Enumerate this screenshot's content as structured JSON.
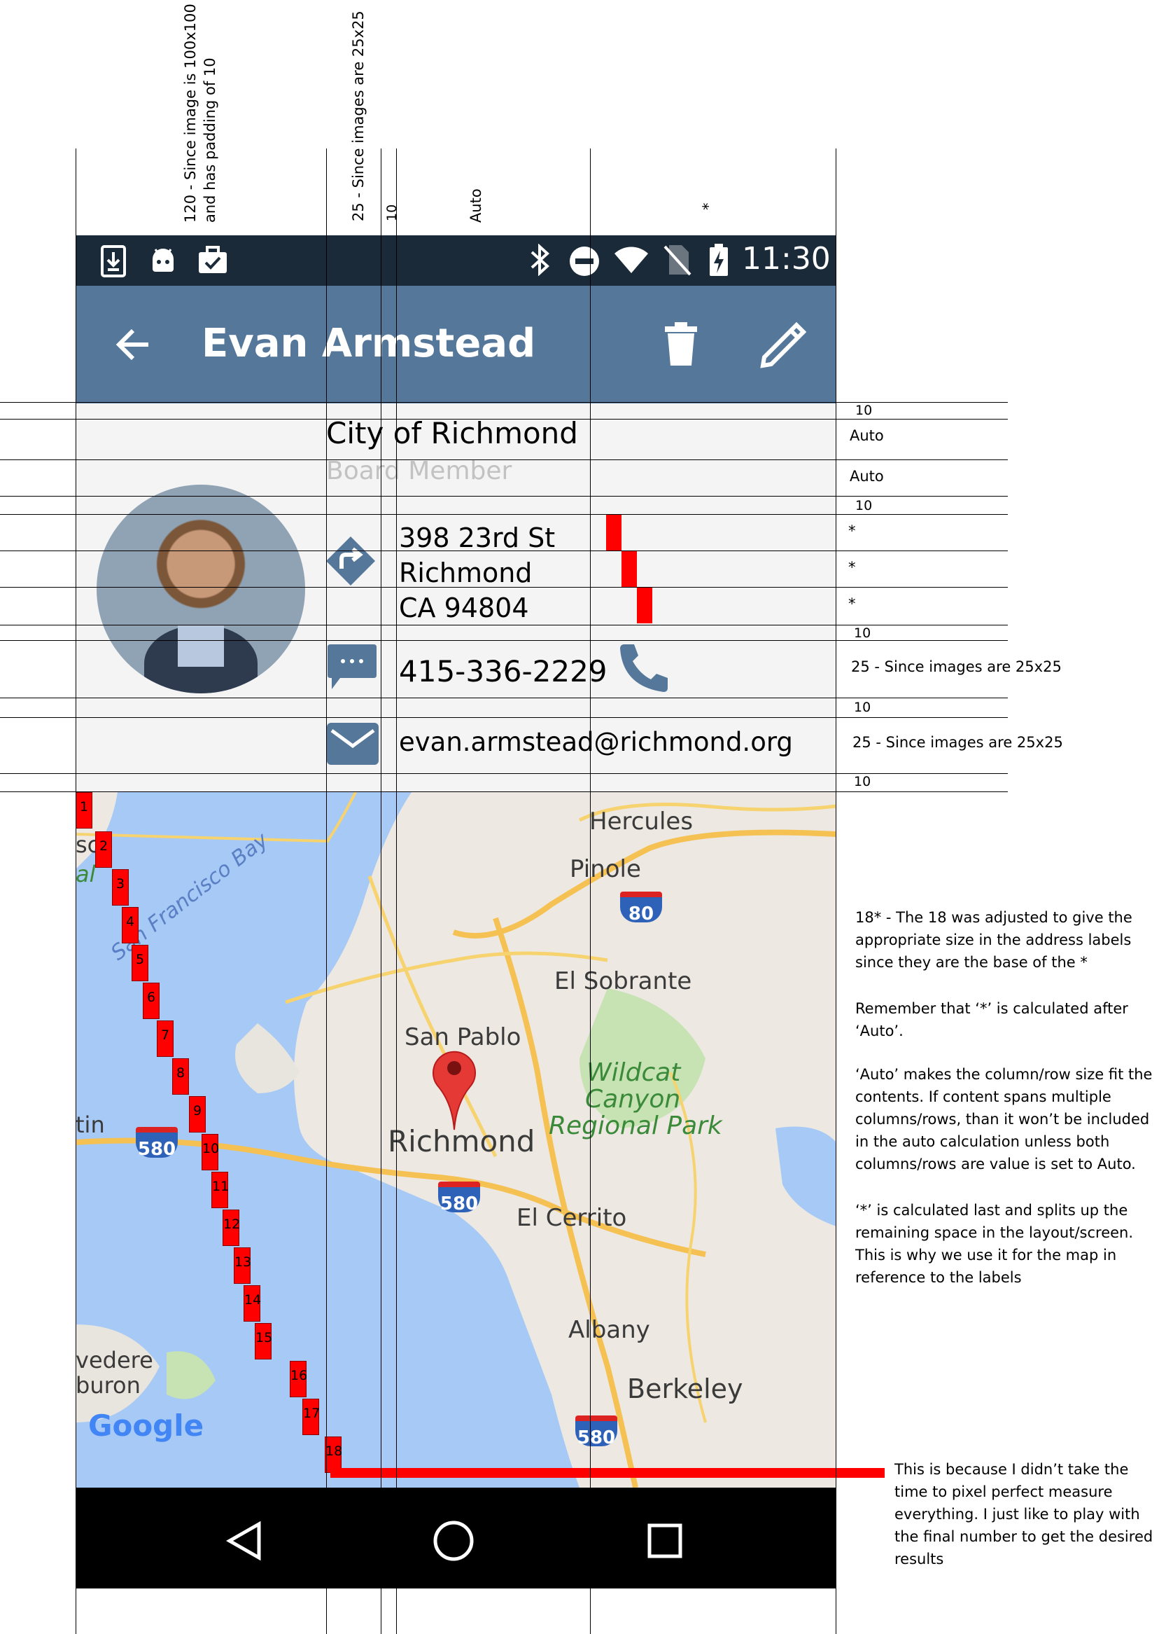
{
  "column_annotations": {
    "col1": "120 - Since image is 100x100\nand has padding of 10",
    "col2": "25 - Since images are 25x25",
    "col3": "10",
    "col4": "Auto",
    "col5": "*"
  },
  "status_bar": {
    "time": "11:30",
    "left_icons": [
      "download-icon",
      "android-icon",
      "briefcase-check-icon"
    ],
    "right_icons": [
      "bluetooth-icon",
      "do-not-disturb-icon",
      "wifi-icon",
      "no-sim-icon",
      "battery-charging-icon"
    ]
  },
  "app_bar": {
    "title": "Evan Armstead",
    "back_icon": "arrow-back-icon",
    "delete_icon": "trash-icon",
    "edit_icon": "pencil-icon",
    "color": "#54779a"
  },
  "contact": {
    "organization": "City of Richmond",
    "role": "Board Member",
    "address_line1": "398 23rd St",
    "address_line2": "Richmond",
    "address_line3": "CA 94804",
    "phone": "415-336-2229",
    "email": "evan.armstead@richmond.org",
    "avatar": "avatar",
    "directions_icon": "directions-icon",
    "message_icon": "message-icon",
    "call_icon": "phone-icon",
    "mail_icon": "mail-icon"
  },
  "row_annotations": {
    "r1": "10",
    "r2": "Auto",
    "r3": "Auto",
    "r4": "10",
    "r5": "*",
    "r6": "*",
    "r7": "*",
    "r8": "10",
    "r9": "25 - Since images are 25x25",
    "r10": "10",
    "r11": "25 - Since images are 25x25",
    "r12": "10"
  },
  "map": {
    "labels": {
      "hercules": "Hercules",
      "pinole": "Pinole",
      "el_sobrante": "El Sobrante",
      "san_pablo": "San Pablo",
      "richmond": "Richmond",
      "wildcat1": "Wildcat",
      "wildcat2": "Canyon",
      "wildcat3": "Regional Park",
      "el_cerrito": "El Cerrito",
      "albany": "Albany",
      "berkeley": "Berkeley",
      "bay": "San Francisco Bay",
      "belvedere": "vedere",
      "tiburon": "buron",
      "tin": "tin",
      "al": "al",
      "sc": "sc",
      "google": "Google",
      "i80": "80",
      "i580a": "580",
      "i580b": "580",
      "i580c": "580"
    },
    "row_steps": [
      "1",
      "2",
      "3",
      "4",
      "5",
      "6",
      "7",
      "8",
      "9",
      "10",
      "11",
      "12",
      "13",
      "14",
      "15",
      "16",
      "17",
      "18"
    ]
  },
  "notes": {
    "note1": "18* - The 18 was adjusted to give the\nappropriate size in the address labels\nsince they are the base of the *",
    "note2": "Remember that ‘*’ is calculated after\n‘Auto’.",
    "note3": "‘Auto’ makes the column/row size fit the\ncontents. If content spans multiple\ncolumns/rows, than it won’t be included\nin the auto calculation unless both\ncolumns/rows are value is set to Auto.",
    "note4": "‘*’ is calculated last and splits up the\nremaining space in the layout/screen.\nThis is why we use it for the map in\nreference to the labels",
    "note5": "This is because I didn’t take the\ntime to pixel perfect measure\neverything. I just like to play with\nthe final number to get the desired\nresults"
  },
  "nav_bar": {
    "back_icon": "nav-back-icon",
    "home_icon": "nav-home-icon",
    "recents_icon": "nav-recents-icon"
  }
}
